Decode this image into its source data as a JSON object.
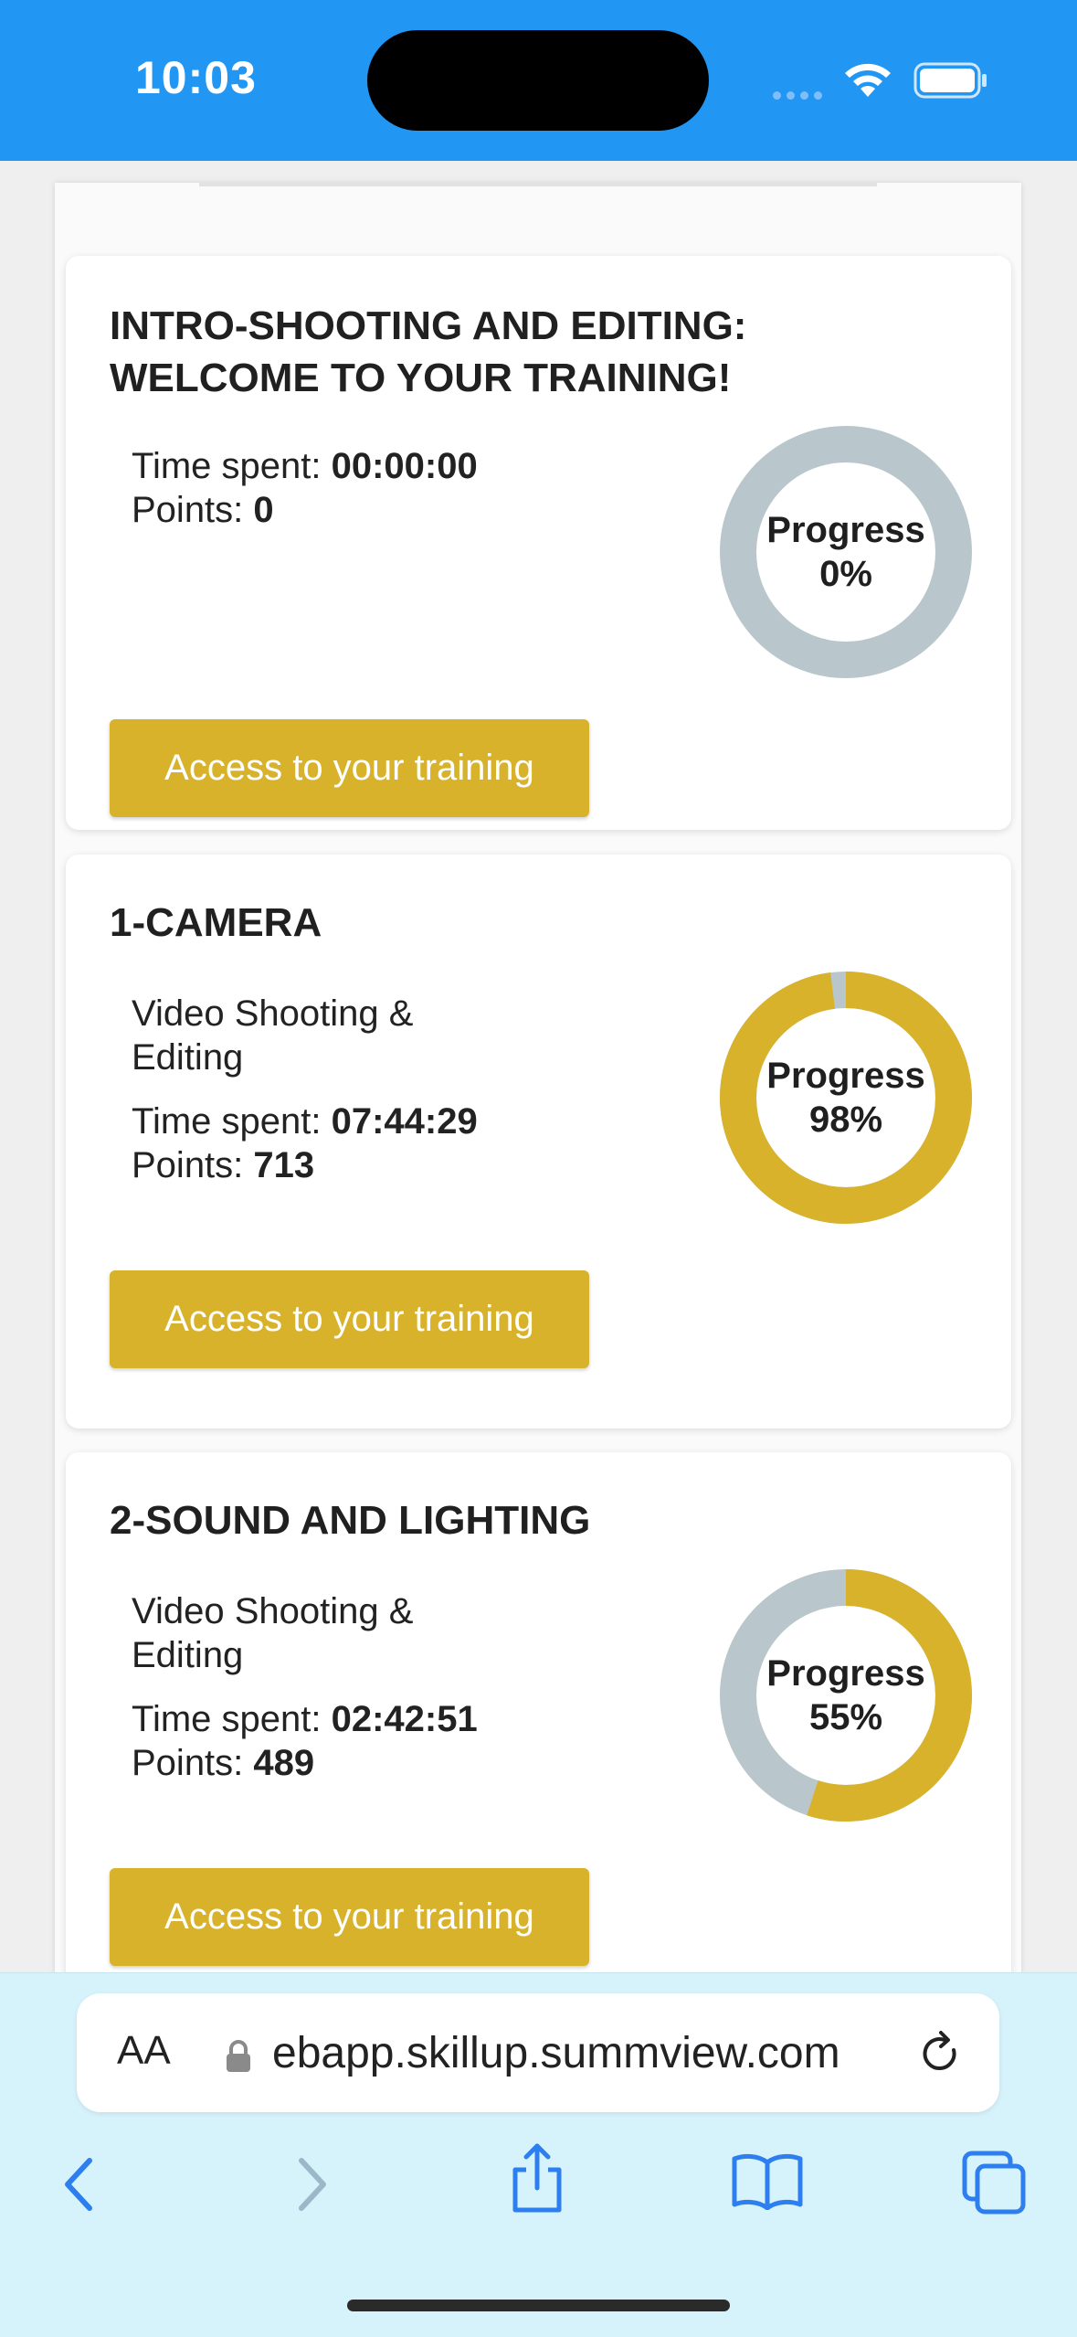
{
  "status_bar": {
    "time": "10:03"
  },
  "cards": [
    {
      "title_line1": "INTRO-SHOOTING AND EDITING:",
      "title_line2": "WELCOME TO YOUR TRAINING!",
      "time_label": "Time spent: ",
      "time_value": "00:00:00",
      "points_label": "Points: ",
      "points_value": "0",
      "progress_label": "Progress",
      "progress_text": "0%",
      "progress": 0,
      "button": "Access to your training"
    },
    {
      "title_line1": "1-CAMERA",
      "subtitle": "Video Shooting & Editing",
      "time_label": "Time spent: ",
      "time_value": "07:44:29",
      "points_label": "Points: ",
      "points_value": "713",
      "progress_label": "Progress",
      "progress_text": "98%",
      "progress": 98,
      "button": "Access to your training"
    },
    {
      "title_line1": "2-SOUND AND LIGHTING",
      "subtitle": "Video Shooting & Editing",
      "time_label": "Time spent: ",
      "time_value": "02:42:51",
      "points_label": "Points: ",
      "points_value": "489",
      "progress_label": "Progress",
      "progress_text": "55%",
      "progress": 55,
      "button": "Access to your training"
    }
  ],
  "browser": {
    "aa_label": "AA",
    "url": "ebapp.skillup.summview.com"
  },
  "colors": {
    "accent": "#d8b22b",
    "track": "#b9c7cc",
    "status_bar": "#2196f3"
  }
}
